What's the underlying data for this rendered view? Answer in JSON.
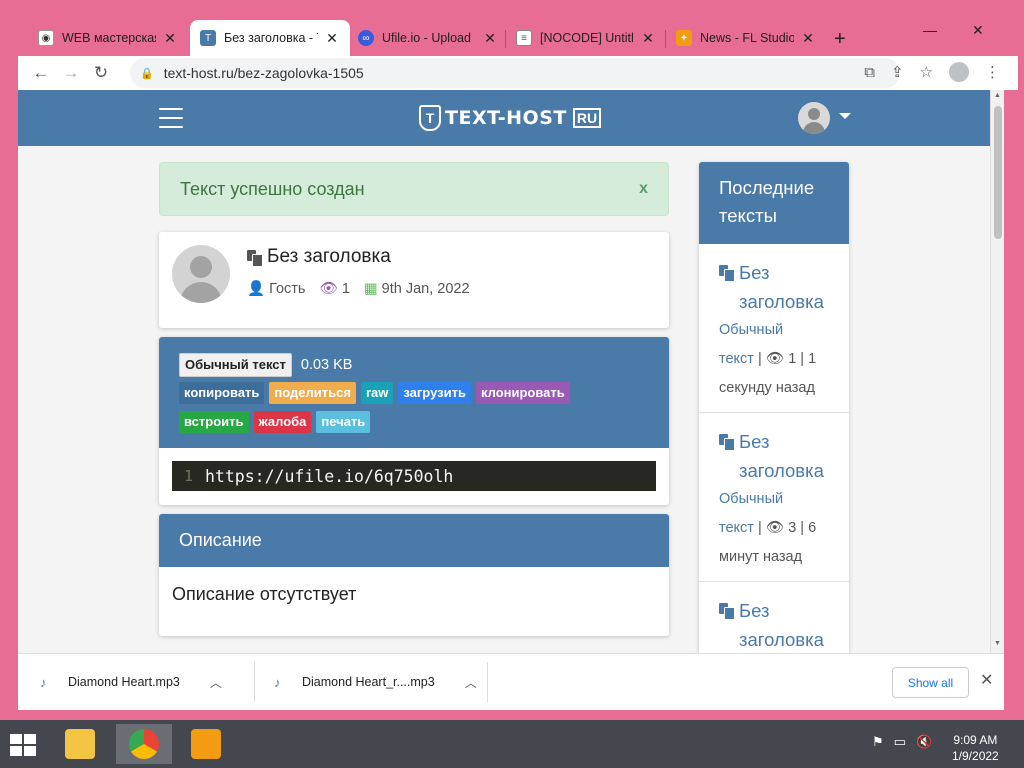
{
  "browser": {
    "tabs": [
      {
        "title": "WEB мастерская",
        "favicon": "eye-favicon",
        "active": false
      },
      {
        "title": "Без заголовка - Т",
        "favicon": "text-host-favicon",
        "active": true
      },
      {
        "title": "Ufile.io - Upload",
        "favicon": "ufile-favicon",
        "active": false
      },
      {
        "title": "[NOCODE] Untitle",
        "favicon": "document-favicon",
        "active": false
      },
      {
        "title": "News - FL Studio",
        "favicon": "fl-studio-favicon",
        "active": false
      }
    ],
    "new_tab_symbol": "+",
    "address": "text-host.ru/bez-zagolovka-1505"
  },
  "site": {
    "logo_text": "TEXT-HOST",
    "logo_suffix": "RU",
    "logo_mark": "T",
    "accent_color": "#4a7aa7"
  },
  "alert": {
    "message": "Текст успешно создан",
    "close_label": "x"
  },
  "paste": {
    "title": "Без заголовка",
    "author": "Гость",
    "views": "1",
    "date": "9th Jan, 2022",
    "type_badge": "Обычный текст",
    "size": "0.03 KB",
    "actions": [
      {
        "label": "копировать",
        "color": "#3d6e99"
      },
      {
        "label": "поделиться",
        "color": "#f0ad4e"
      },
      {
        "label": "raw",
        "color": "#17a2b8"
      },
      {
        "label": "загрузить",
        "color": "#2f80ed"
      },
      {
        "label": "клонировать",
        "color": "#9b59b6"
      },
      {
        "label": "встроить",
        "color": "#28a745"
      },
      {
        "label": "жалоба",
        "color": "#dc3545"
      },
      {
        "label": "печать",
        "color": "#5bc0de"
      }
    ],
    "code_line_number": "1",
    "code_text": "https://ufile.io/6q750olh"
  },
  "description": {
    "heading": "Описание",
    "body": "Описание отсутствует"
  },
  "sidebar": {
    "heading_line1": "Последние",
    "heading_line2": "тексты",
    "items": [
      {
        "title_line1": "Без",
        "title_line2": "заголовка",
        "type_line1": "Обычный",
        "type_line2": "текст",
        "stats": " | 👁 1 | 1",
        "ago": "секунду назад"
      },
      {
        "title_line1": "Без",
        "title_line2": "заголовка",
        "type_line1": "Обычный",
        "type_line2": "текст",
        "stats": " | 👁 3 | 6",
        "ago": "минут назад"
      },
      {
        "title_line1": "Без",
        "title_line2": "заголовка",
        "type_line1": "",
        "type_line2": "",
        "stats": "",
        "ago": ""
      }
    ]
  },
  "downloads": {
    "items": [
      {
        "filename": "Diamond Heart.mp3"
      },
      {
        "filename": "Diamond Heart_r....mp3"
      }
    ],
    "show_all_label": "Show all"
  },
  "taskbar": {
    "time": "9:09 AM",
    "date": "1/9/2022"
  }
}
